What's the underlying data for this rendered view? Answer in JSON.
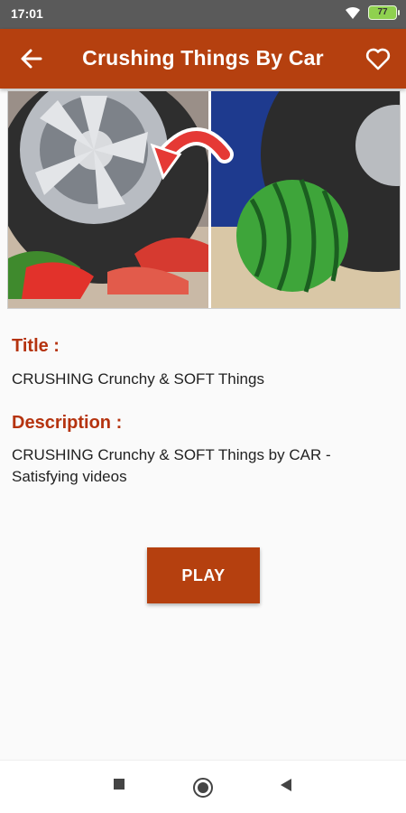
{
  "status_bar": {
    "time": "17:01",
    "battery": "77",
    "icons": [
      "wifi-icon",
      "battery-icon"
    ]
  },
  "app_bar": {
    "title": "Crushing Things By Car",
    "back_icon": "arrow-left-icon",
    "favorite_icon": "heart-outline-icon",
    "color": "#b5400f"
  },
  "video": {
    "title_label": "Title :",
    "title": "CRUSHING Crunchy & SOFT Things",
    "description_label": "Description :",
    "description": "CRUSHING Crunchy & SOFT Things by CAR - Satisfying videos"
  },
  "actions": {
    "play_label": "PLAY"
  },
  "nav_bar": {
    "icons": [
      "recents-square-icon",
      "home-circle-icon",
      "back-triangle-icon"
    ]
  }
}
